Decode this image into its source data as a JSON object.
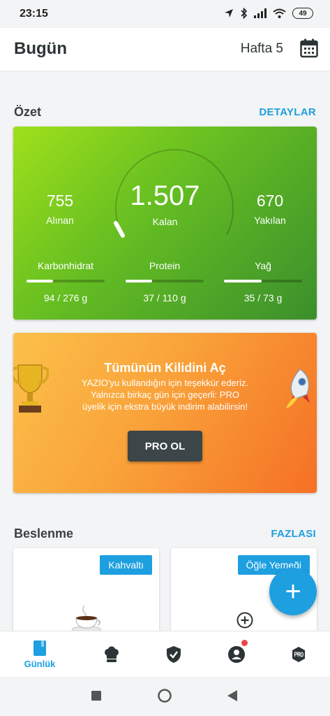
{
  "status_bar": {
    "time": "23:15",
    "battery": "49"
  },
  "header": {
    "title": "Bugün",
    "week": "Hafta 5"
  },
  "summary": {
    "title": "Özet",
    "link": "DETAYLAR",
    "eaten": {
      "value": "755",
      "label": "Alınan"
    },
    "remaining": {
      "value": "1.507",
      "label": "Kalan"
    },
    "burned": {
      "value": "670",
      "label": "Yakılan"
    },
    "macros": [
      {
        "name": "Karbonhidrat",
        "value": "94 / 276 g",
        "progress": 0.34
      },
      {
        "name": "Protein",
        "value": "37 / 110 g",
        "progress": 0.34
      },
      {
        "name": "Yağ",
        "value": "35 / 73 g",
        "progress": 0.48
      }
    ]
  },
  "pro": {
    "title": "Tümünün Kilidini Aç",
    "line1": "YAZIO'yu kullandığın için teşekkür ederiz.",
    "line2": "Yalnızca birkaç gün için geçerli: PRO",
    "line3": "üyelik için ekstra büyük indirim alabilirsin!",
    "button": "PRO OL"
  },
  "nutrition": {
    "title": "Beslenme",
    "link": "FAZLASI",
    "meals": [
      {
        "label": "Kahvaltı"
      },
      {
        "label": "Öğle Yemeği"
      }
    ]
  },
  "fab": {
    "label": "+"
  },
  "nav": {
    "items": [
      {
        "label": "Günlük",
        "icon": "diary-icon"
      },
      {
        "icon": "chef-hat-icon"
      },
      {
        "icon": "shield-check-icon"
      },
      {
        "icon": "profile-icon"
      },
      {
        "icon": "pro-icon"
      }
    ]
  },
  "colors": {
    "accent": "#1d9fe0",
    "summary_start": "#9fe01b",
    "summary_end": "#3b8f2c",
    "pro_start": "#fcc04a",
    "pro_end": "#f57025"
  }
}
